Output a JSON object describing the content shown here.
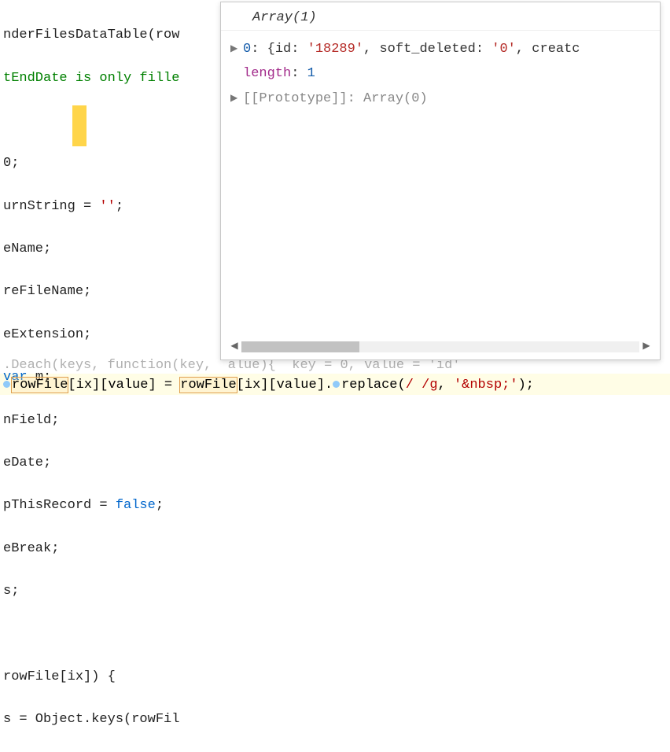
{
  "code": {
    "l1a": "nderFilesDataTable(row",
    "l2a": "tEndDate is only fille",
    "l4": "0;",
    "l5a": "urnString = ",
    "l5b": "''",
    "l5c": ";",
    "l6": "eName;",
    "l7": "reFileName;",
    "l8": "eExtension;",
    "l9a": "var ",
    "l9b": "m;",
    "l10": "nField;",
    "l11": "eDate;",
    "l12a": "pThisRecord = ",
    "l12b": "false",
    "l12c": ";",
    "l13": "eBreak;",
    "l14": "s;",
    "l16": "rowFile[ix]) {",
    "l17": "s = Object.keys(rowFil",
    "l18": ".Deach(keys, function(key,  alue){  key = 0, value = 'id'",
    "l19a": "rowFile",
    "l19b": "[ix][value] = ",
    "l19c": "rowFile",
    "l19d": "[ix][value].",
    "l19e": "replace(",
    "l19f": "/ /g",
    "l19g": ", ",
    "l19h": "'&nbsp;'",
    "l19i": ");"
  },
  "tooltip": {
    "header": "Array(1)",
    "row0_key": "0",
    "row0_open": ": {",
    "row0_id_k": "id",
    "row0_id_v": "'18289'",
    "row0_sd_k": "soft_deleted",
    "row0_sd_v": "'0'",
    "row0_trail": ", creatc",
    "length_k": "length",
    "length_v": "1",
    "proto": "[[Prototype]]: ",
    "proto_v": "Array(0)"
  }
}
